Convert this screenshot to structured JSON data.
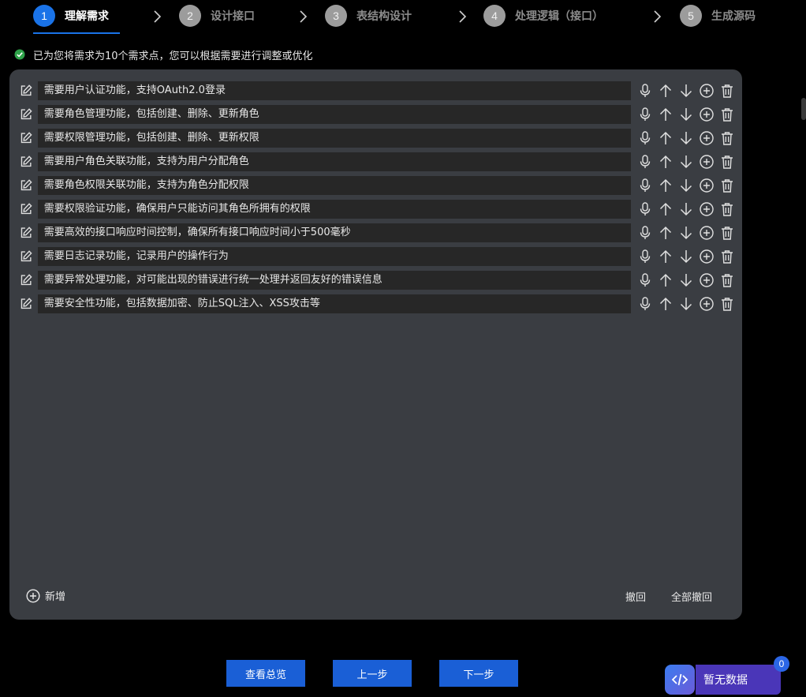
{
  "steps": [
    {
      "num": "1",
      "label": "理解需求",
      "active": true
    },
    {
      "num": "2",
      "label": "设计接口",
      "active": false
    },
    {
      "num": "3",
      "label": "表结构设计",
      "active": false
    },
    {
      "num": "4",
      "label": "处理逻辑（接口）",
      "active": false
    },
    {
      "num": "5",
      "label": "生成源码",
      "active": false
    }
  ],
  "notice": "已为您将需求为10个需求点，您可以根据需要进行调整或优化",
  "requirements": [
    "需要用户认证功能，支持OAuth2.0登录",
    "需要角色管理功能，包括创建、删除、更新角色",
    "需要权限管理功能，包括创建、删除、更新权限",
    "需要用户角色关联功能，支持为用户分配角色",
    "需要角色权限关联功能，支持为角色分配权限",
    "需要权限验证功能，确保用户只能访问其角色所拥有的权限",
    "需要高效的接口响应时间控制，确保所有接口响应时间小于500毫秒",
    "需要日志记录功能，记录用户的操作行为",
    "需要异常处理功能，对可能出现的错误进行统一处理并返回友好的错误信息",
    "需要安全性功能，包括数据加密、防止SQL注入、XSS攻击等"
  ],
  "panel": {
    "add_label": "新增",
    "undo_label": "撤回",
    "undo_all_label": "全部撤回"
  },
  "buttons": {
    "overview": "查看总览",
    "prev": "上一步",
    "next": "下一步"
  },
  "widget": {
    "label": "暂无数据",
    "badge": "0",
    "icon": "code-icon"
  },
  "colors": {
    "accent": "#1a73e8",
    "button": "#1a5fd6",
    "panel": "#3a3d42",
    "field": "#272727",
    "success": "#2fa34a",
    "widget": "#4a36b8"
  }
}
